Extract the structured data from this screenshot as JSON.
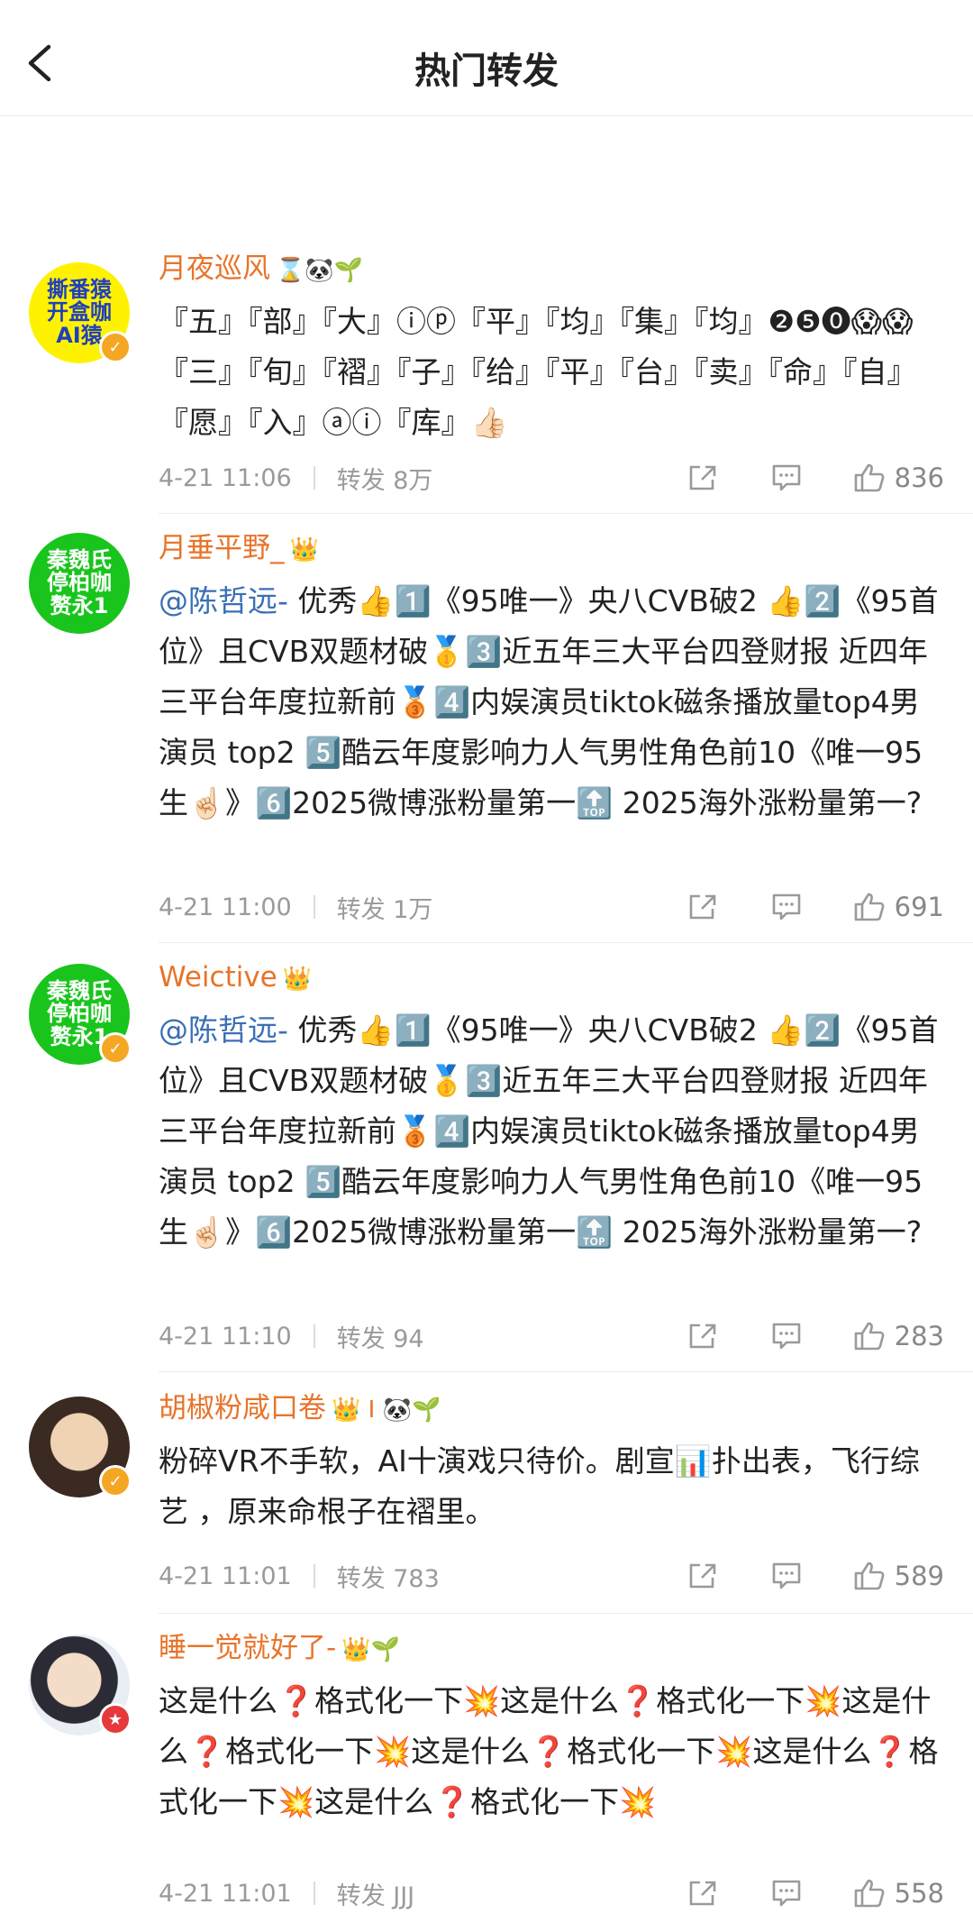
{
  "header": {
    "title": "热门转发"
  },
  "posts": [
    {
      "avatar_text": "撕番猿\n开盒咖\nAI猿",
      "username": "月夜巡风",
      "badges": "⌛🐼🌱",
      "text": "『五』『部』『大』ⓘⓟ『平』『均』『集』『均』❷❺⓿😱😱『三』『旬』『褶』『子』『给』『平』『台』『卖』『命』『自』『愿』『入』ⓐⓘ『库』👍🏻",
      "time": "4-21 11:06",
      "repost": "转发 8万",
      "likes": "836"
    },
    {
      "avatar_text": "秦魏氏\n停柏咖\n赘永1",
      "username": "月垂平野_",
      "badges": "👑",
      "mention": "@陈哲远-",
      "text": " 优秀👍1️⃣《95唯一》央八CVB破2 👍2️⃣《95首位》且CVB双题材破🥇3️⃣近五年三大平台四登财报 近四年三平台年度拉新前🥉4️⃣内娱演员tiktok磁条播放量top4男演员 top2 5️⃣酷云年度影响力人气男性角色前10《唯一95生☝🏻》6️⃣2025微博涨粉量第一🔝 2025海外涨粉量第一?",
      "time": "4-21 11:00",
      "repost": "转发 1万",
      "likes": "691"
    },
    {
      "avatar_text": "秦魏氏\n停柏咖\n赘永1",
      "username": "Weictive",
      "badges": "👑",
      "mention": "@陈哲远-",
      "text": " 优秀👍1️⃣《95唯一》央八CVB破2 👍2️⃣《95首位》且CVB双题材破🥇3️⃣近五年三大平台四登财报 近四年三平台年度拉新前🥉4️⃣内娱演员tiktok磁条播放量top4男演员 top2 5️⃣酷云年度影响力人气男性角色前10《唯一95生☝🏻》6️⃣2025微博涨粉量第一🔝 2025海外涨粉量第一?",
      "time": "4-21 11:10",
      "repost": "转发 94",
      "likes": "283"
    },
    {
      "avatar_text": "",
      "username": "胡椒粉咸口卷",
      "badges": "👑 I 🐼🌱",
      "text": "粉碎VR不手软，AI十演戏只待价。剧宣📊扑出表，飞行综艺 ，原来命根子在褶里。",
      "time": "4-21 11:01",
      "repost": "转发 783",
      "likes": "589"
    },
    {
      "avatar_text": "",
      "username": "睡一觉就好了-",
      "badges": "👑🌱",
      "text": "这是什么❓格式化一下💥这是什么❓格式化一下💥这是什么❓格式化一下💥这是什么❓格式化一下💥这是什么❓格式化一下💥这是什么❓格式化一下💥",
      "time": "4-21 11:01",
      "repost": "转发 JJJ",
      "likes": "558"
    }
  ],
  "icons": [
    "back-icon",
    "share-icon",
    "comment-icon",
    "like-icon",
    "verified-icon"
  ],
  "colors": {
    "username": "#e8742a",
    "mention": "#3b6fb5",
    "meta": "#9a9a9a",
    "verified": "#f5a623"
  }
}
